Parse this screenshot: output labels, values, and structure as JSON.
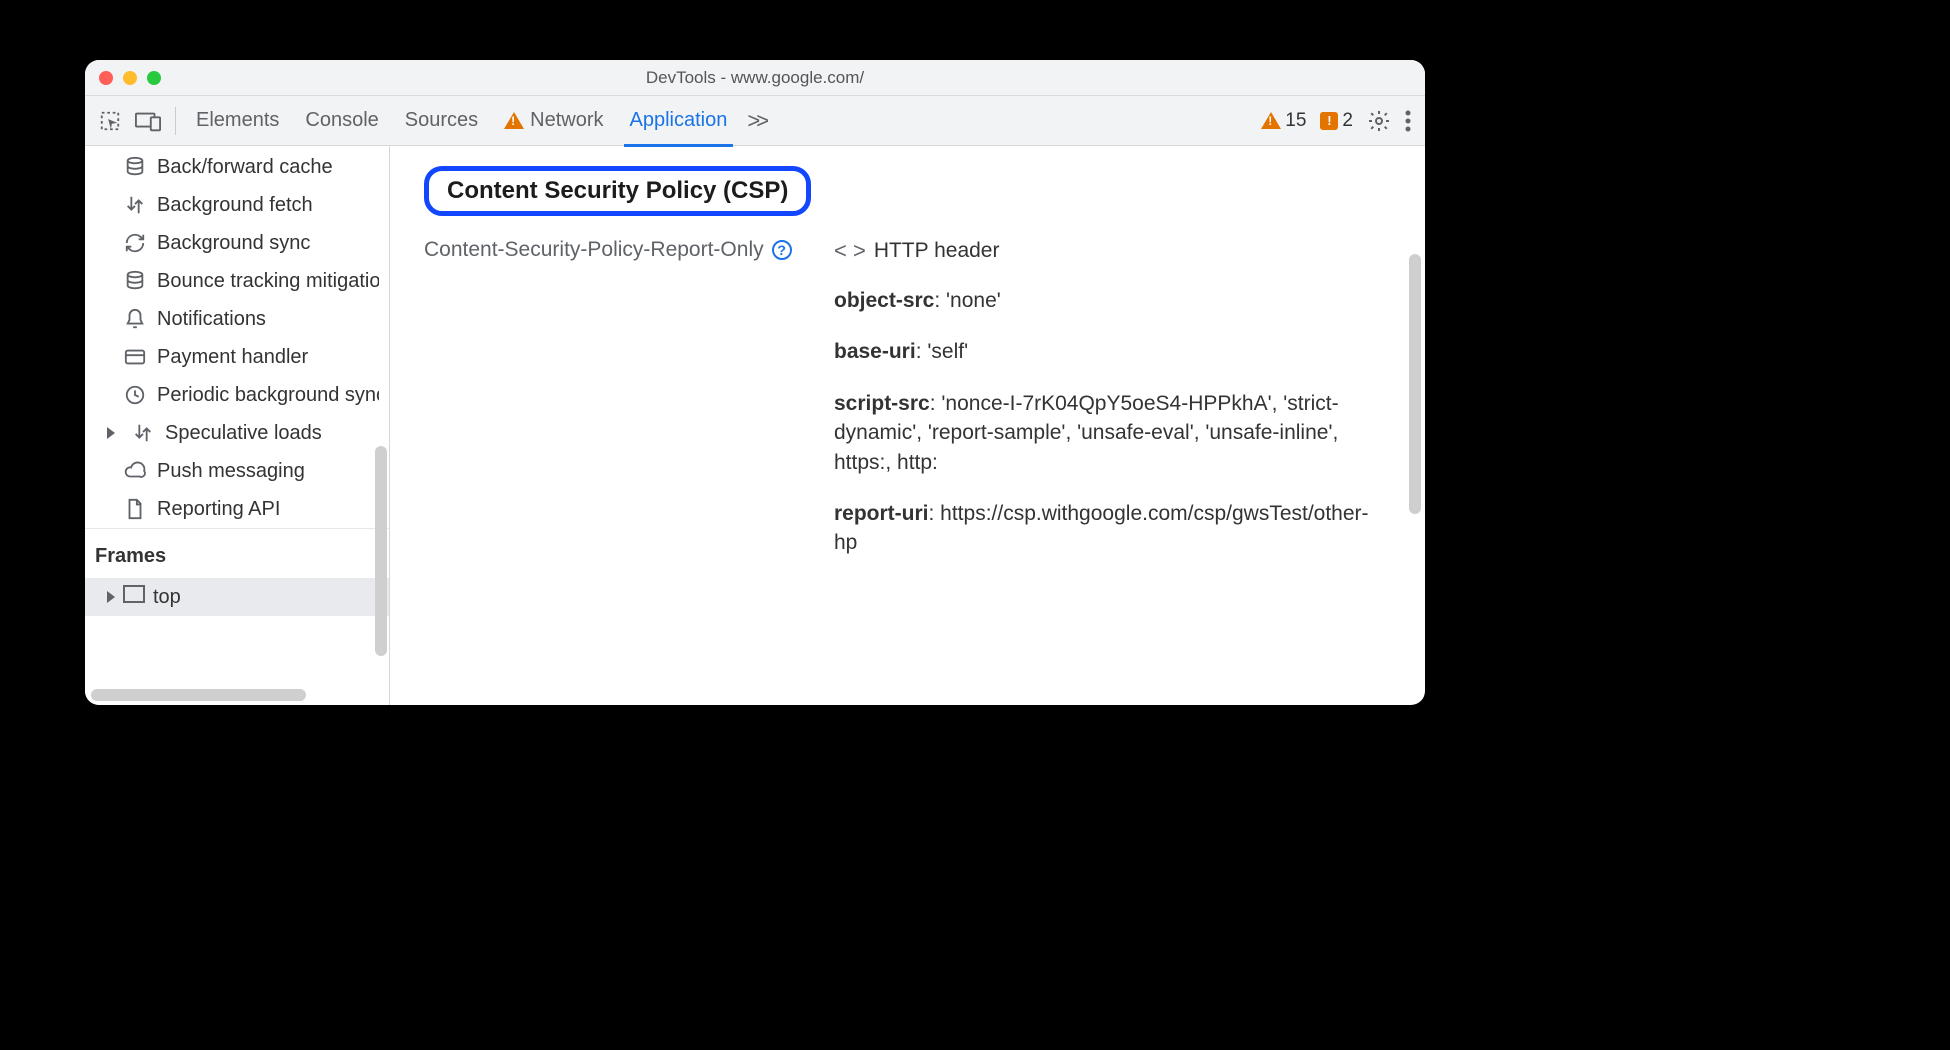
{
  "window": {
    "title": "DevTools - www.google.com/"
  },
  "tabstrip": {
    "tabs": [
      "Elements",
      "Console",
      "Sources",
      "Network",
      "Application"
    ],
    "active_index": 4,
    "more": ">>",
    "warnings_count": "15",
    "issues_count": "2"
  },
  "sidebar": {
    "items": [
      {
        "icon": "database-icon",
        "label": "Back/forward cache"
      },
      {
        "icon": "bgfetch-icon",
        "label": "Background fetch"
      },
      {
        "icon": "sync-icon",
        "label": "Background sync"
      },
      {
        "icon": "database-icon",
        "label": "Bounce tracking mitigations"
      },
      {
        "icon": "bell-icon",
        "label": "Notifications"
      },
      {
        "icon": "card-icon",
        "label": "Payment handler"
      },
      {
        "icon": "clock-icon",
        "label": "Periodic background sync"
      },
      {
        "icon": "bgfetch-icon",
        "label": "Speculative loads",
        "expandable": true
      },
      {
        "icon": "cloud-icon",
        "label": "Push messaging"
      },
      {
        "icon": "file-icon",
        "label": "Reporting API"
      }
    ],
    "frames_header": "Frames",
    "frame_top": "top"
  },
  "content": {
    "heading": "Content Security Policy (CSP)",
    "policy_name": "Content-Security-Policy-Report-Only",
    "source_label": "HTTP header",
    "directives": [
      {
        "name": "object-src",
        "value": "'none'"
      },
      {
        "name": "base-uri",
        "value": "'self'"
      },
      {
        "name": "script-src",
        "value": "'nonce-I-7rK04QpY5oeS4-HPPkhA', 'strict-dynamic', 'report-sample', 'unsafe-eval', 'unsafe-inline', https:, http:"
      },
      {
        "name": "report-uri",
        "value": "https://csp.withgoogle.com/csp/gwsTest/other-hp"
      }
    ]
  }
}
